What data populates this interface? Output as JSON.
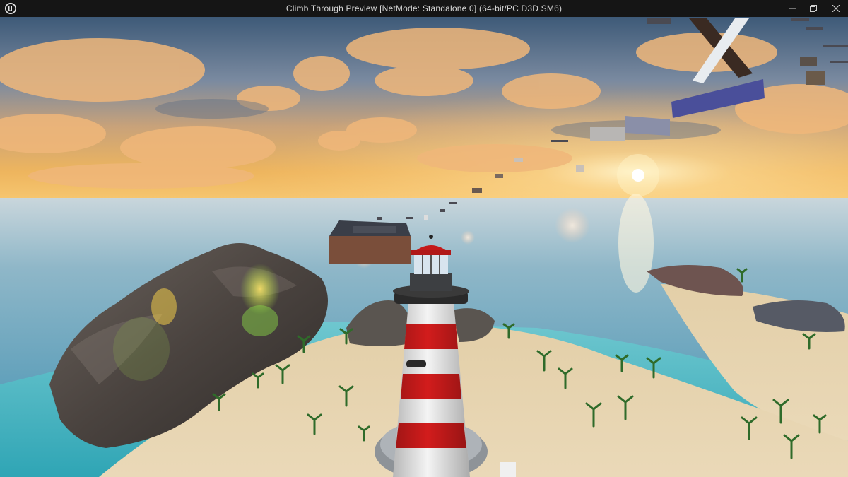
{
  "window": {
    "title": "Climb Through Preview [NetMode: Standalone 0]  (64-bit/PC D3D SM6)",
    "app_icon": "unreal-engine-logo-icon",
    "controls": [
      "minimize-icon",
      "maximize-icon",
      "close-icon"
    ]
  },
  "scene": {
    "description_icons": [
      "sun-icon",
      "lighthouse",
      "rock-island",
      "floating-platforms",
      "palm-trees"
    ],
    "colors": {
      "sky_top": "#3e5a78",
      "sky_horizon": "#f2b25a",
      "ocean": "#5e9fba",
      "sand": "#e6d3b0",
      "lighthouse_red": "#d21c1c",
      "lighthouse_white": "#f4f4f4"
    }
  }
}
